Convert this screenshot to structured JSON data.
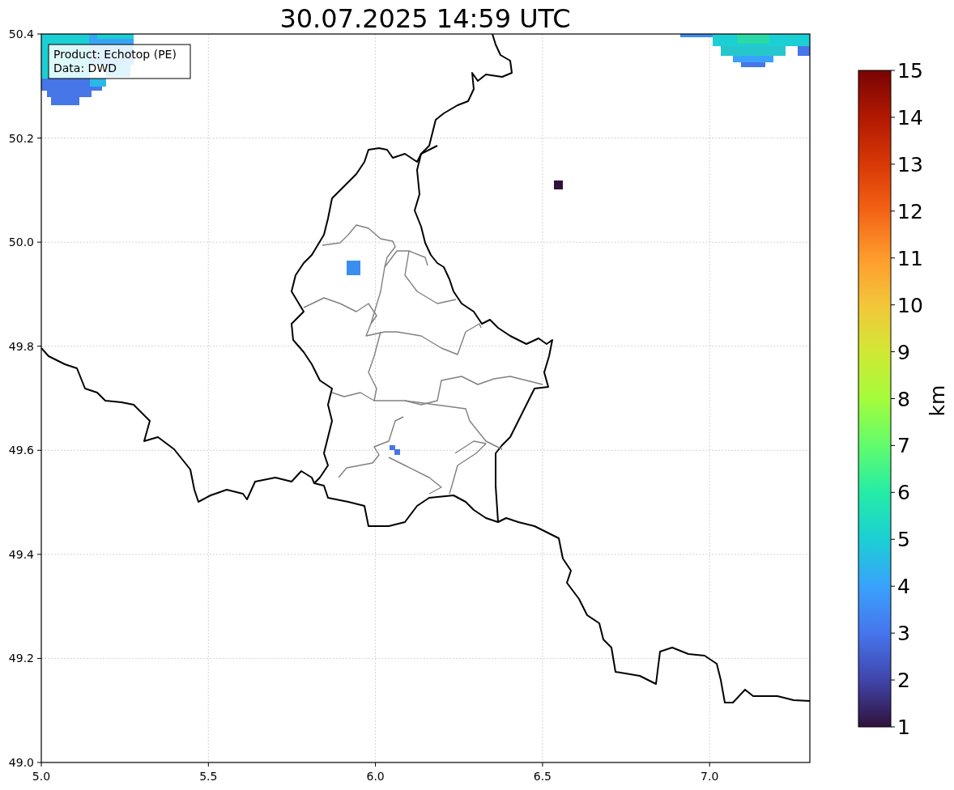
{
  "title": "30.07.2025 14:59 UTC",
  "legend": {
    "lines": [
      "Product: Echotop (PE)",
      "Data: DWD"
    ]
  },
  "x_axis": {
    "ticks": [
      "5.0",
      "5.5",
      "6.0",
      "6.5",
      "7.0"
    ]
  },
  "y_axis": {
    "ticks": [
      "50.4",
      "50.2",
      "50.0",
      "49.8",
      "49.6",
      "49.4",
      "49.2",
      "49.0"
    ]
  },
  "colorbar": {
    "ticks": [
      "15",
      "14",
      "13",
      "12",
      "11",
      "10",
      "9",
      "8",
      "7",
      "6",
      "5",
      "4",
      "3",
      "2",
      "1"
    ],
    "label": "km"
  }
}
